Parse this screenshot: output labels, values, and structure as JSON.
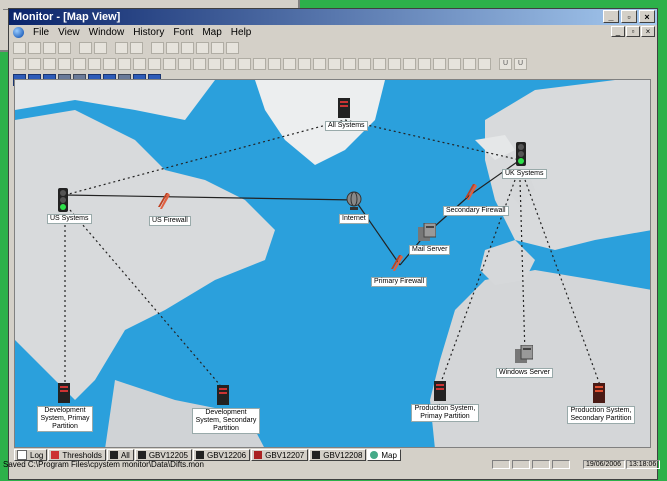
{
  "window": {
    "title": "Monitor - [Map View]"
  },
  "menu": [
    "File",
    "View",
    "Window",
    "History",
    "Font",
    "Map",
    "Help"
  ],
  "map": {
    "nodes": [
      {
        "id": "us-systems",
        "label": "US Systems",
        "kind": "traffic-light"
      },
      {
        "id": "us-firewall",
        "label": "US Firewall",
        "kind": "firewall"
      },
      {
        "id": "all-systems",
        "label": "All Systems",
        "kind": "server"
      },
      {
        "id": "internet",
        "label": "Internet",
        "kind": "globe"
      },
      {
        "id": "uk-systems",
        "label": "UK Systems",
        "kind": "traffic-light"
      },
      {
        "id": "secondary-firewall",
        "label": "Secondary Firewall",
        "kind": "firewall"
      },
      {
        "id": "mail-server",
        "label": "Mail Server",
        "kind": "pc"
      },
      {
        "id": "primary-firewall",
        "label": "Primary Firewall",
        "kind": "firewall"
      },
      {
        "id": "windows-server",
        "label": "Windows Server",
        "kind": "pc"
      },
      {
        "id": "dev-primary",
        "label": "Development System, Primay Partition",
        "kind": "server"
      },
      {
        "id": "dev-secondary",
        "label": "Development System, Secondary Partition",
        "kind": "server"
      },
      {
        "id": "prod-primary",
        "label": "Production System, Primay Partition",
        "kind": "server"
      },
      {
        "id": "prod-secondary",
        "label": "Production System, Secondary Partition",
        "kind": "server"
      }
    ]
  },
  "tabs": [
    {
      "label": "Log",
      "icon": "log-icon"
    },
    {
      "label": "Thresholds",
      "icon": "thresholds-icon"
    },
    {
      "label": "All",
      "icon": "server-icon"
    },
    {
      "label": "GBV12205",
      "icon": "server-icon"
    },
    {
      "label": "GBV12206",
      "icon": "server-icon"
    },
    {
      "label": "GBV12207",
      "icon": "server-icon"
    },
    {
      "label": "GBV12208",
      "icon": "server-icon"
    },
    {
      "label": "Map",
      "icon": "globe-icon"
    }
  ],
  "status": {
    "message": "Saved C:\\Program Files\\cpystem monitor\\Data\\Difts.mon",
    "date": "19/06/2006",
    "time": "13:18:06"
  }
}
